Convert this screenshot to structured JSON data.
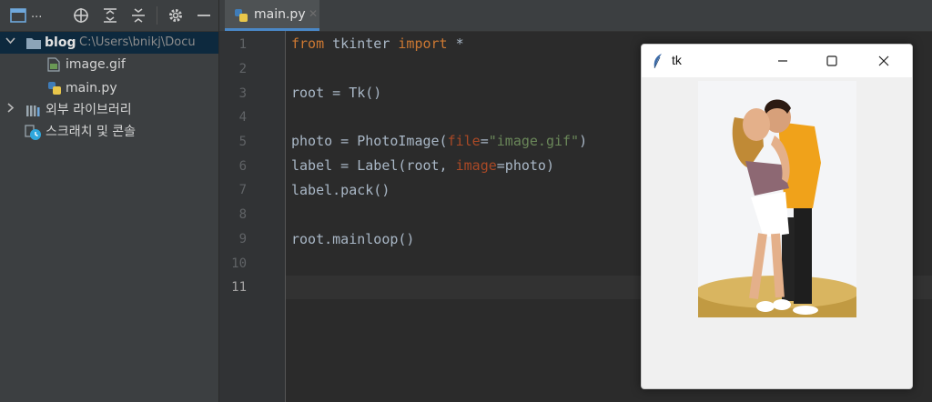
{
  "sidebar": {
    "toolbar": {
      "project_dots": "...",
      "icons": [
        "window-icon",
        "crosshair-icon",
        "expand-all-icon",
        "collapse-all-icon",
        "gear-icon",
        "minimize-icon"
      ]
    },
    "tree": [
      {
        "label": "blog",
        "path": "C:\\Users\\bnikj\\Docu",
        "icon": "folder-icon",
        "expanded": true
      },
      {
        "label": "image.gif",
        "icon": "gif-file-icon"
      },
      {
        "label": "main.py",
        "icon": "python-file-icon"
      },
      {
        "label": "외부 라이브러리",
        "icon": "library-icon",
        "expanded": false
      },
      {
        "label": "스크래치 및 콘솔",
        "icon": "scratch-console-icon"
      }
    ]
  },
  "editor": {
    "tab": {
      "label": "main.py",
      "close": "✕",
      "icon": "python-file-icon"
    },
    "line_numbers": [
      "1",
      "2",
      "3",
      "4",
      "5",
      "6",
      "7",
      "8",
      "9",
      "10",
      "11"
    ],
    "current_line": 11,
    "code": {
      "l1_from": "from",
      "l1_mod": " tkinter ",
      "l1_import": "import",
      "l1_star": " *",
      "l3": "root = Tk()",
      "l5_a": "photo = PhotoImage(",
      "l5_param": "file",
      "l5_eq": "=",
      "l5_str": "\"image.gif\"",
      "l5_end": ")",
      "l6_a": "label = Label(root, ",
      "l6_param": "image",
      "l6_b": "=photo)",
      "l7": "label.pack()",
      "l9": "root.mainloop()"
    }
  },
  "tk_window": {
    "title": "tk",
    "icon": "feather-icon",
    "minimize": "—",
    "maximize": "☐",
    "close": "✕",
    "image": "kissing-couple-figurine-on-coin"
  },
  "colors": {
    "keyword": "#cc7832",
    "param": "#aa4926",
    "string": "#6a8759",
    "text": "#a9b7c6",
    "selection": "#0d293e"
  }
}
